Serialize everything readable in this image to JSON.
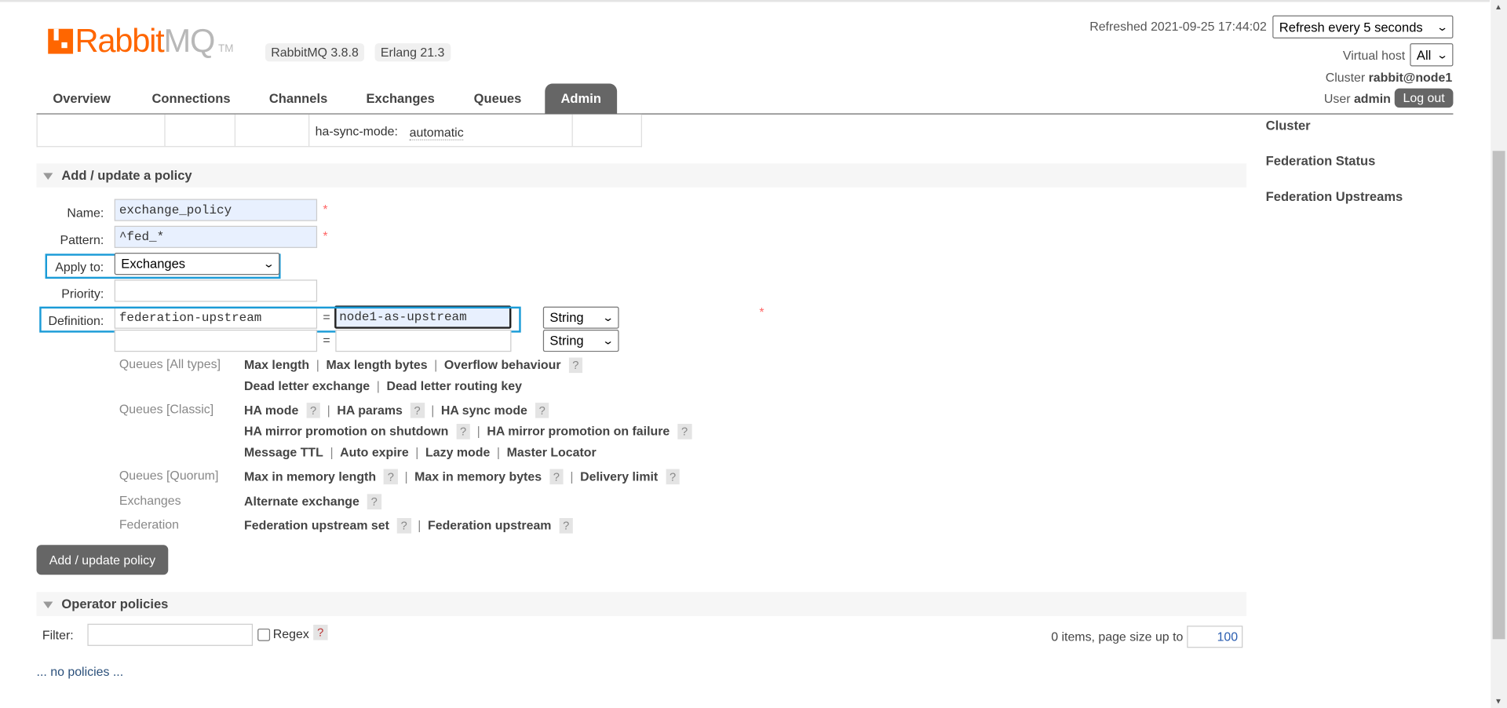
{
  "header": {
    "logo_text_orange": "Rabbit",
    "logo_text_gray": "MQ",
    "logo_tm": "TM",
    "version_badge": "RabbitMQ 3.8.8",
    "erlang_badge": "Erlang 21.3",
    "refreshed": "Refreshed 2021-09-25 17:44:02",
    "refresh_select": "Refresh every 5 seconds",
    "vhost_label": "Virtual host",
    "vhost_select": "All",
    "cluster_label": "Cluster",
    "cluster_value": "rabbit@node1",
    "user_label": "User",
    "user_value": "admin",
    "logout": "Log out"
  },
  "tabs": [
    {
      "label": "Overview"
    },
    {
      "label": "Connections"
    },
    {
      "label": "Channels"
    },
    {
      "label": "Exchanges"
    },
    {
      "label": "Queues"
    },
    {
      "label": "Admin",
      "active": true
    }
  ],
  "remnant_row": {
    "key": "ha-sync-mode:",
    "value": "automatic"
  },
  "sidebar": {
    "items": [
      {
        "label": "Cluster"
      },
      {
        "label": "Federation Status"
      },
      {
        "label": "Federation Upstreams"
      }
    ]
  },
  "policy_form": {
    "section_title": "Add / update a policy",
    "name_label": "Name:",
    "name_value": "exchange_policy",
    "pattern_label": "Pattern:",
    "pattern_value": "^fed_*",
    "apply_label": "Apply to:",
    "apply_value": "Exchanges",
    "priority_label": "Priority:",
    "priority_value": "",
    "definition_label": "Definition:",
    "definitions": [
      {
        "key": "federation-upstream",
        "value": "node1-as-upstream",
        "type": "String"
      },
      {
        "key": "",
        "value": "",
        "type": "String"
      }
    ],
    "equals": "=",
    "required_mark": "*",
    "help_mark": "?",
    "categories": [
      {
        "label": "Queues [All types]",
        "lines": [
          [
            "Max length",
            "Max length bytes",
            "Overflow behaviour?"
          ],
          [
            "Dead letter exchange",
            "Dead letter routing key"
          ]
        ]
      },
      {
        "label": "Queues [Classic]",
        "lines": [
          [
            "HA mode?",
            "HA params?",
            "HA sync mode?"
          ],
          [
            "HA mirror promotion on shutdown?",
            "HA mirror promotion on failure?"
          ],
          [
            "Message TTL",
            "Auto expire",
            "Lazy mode",
            "Master Locator"
          ]
        ]
      },
      {
        "label": "Queues [Quorum]",
        "lines": [
          [
            "Max in memory length?",
            "Max in memory bytes?",
            "Delivery limit?"
          ]
        ]
      },
      {
        "label": "Exchanges",
        "lines": [
          [
            "Alternate exchange?"
          ]
        ]
      },
      {
        "label": "Federation",
        "lines": [
          [
            "Federation upstream set?",
            "Federation upstream?"
          ]
        ]
      }
    ],
    "submit": "Add / update policy"
  },
  "operator_policies": {
    "section_title": "Operator policies",
    "filter_label": "Filter:",
    "filter_value": "",
    "regex_label": "Regex",
    "items_text": "0 items, page size up to",
    "page_size": "100",
    "empty_text": "... no policies ..."
  },
  "colors": {
    "brand": "#ff6600",
    "highlight": "#1a9bd7",
    "dark_button": "#666666"
  }
}
